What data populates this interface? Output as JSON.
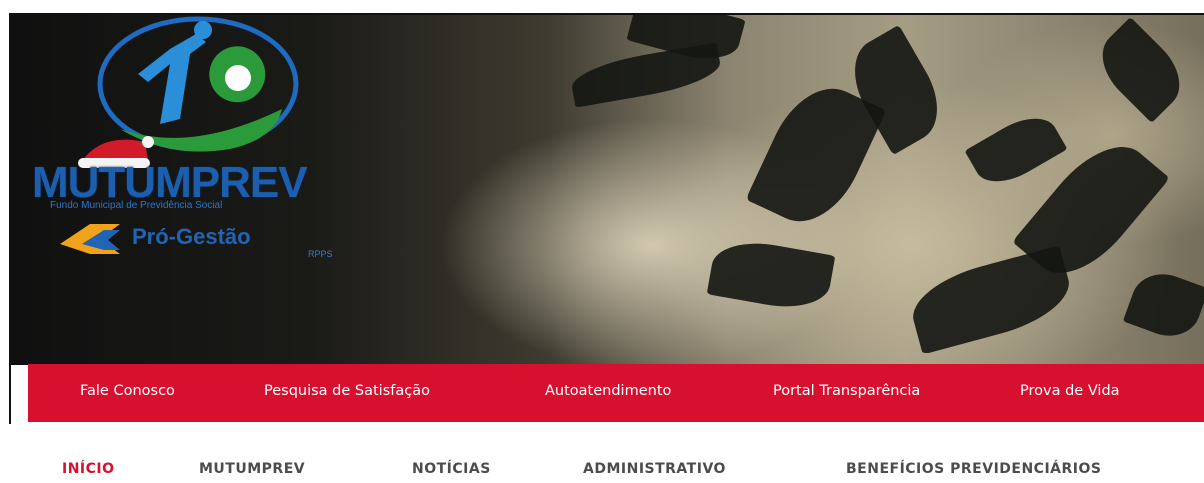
{
  "logo": {
    "brand_name": "MUTUMPREV",
    "brand_subtitle": "Fundo Municipal de Previdência Social",
    "certification": "Pró-Gestão",
    "certification_sub": "RPPS"
  },
  "top_nav": {
    "items": [
      {
        "label": "Fale Conosco"
      },
      {
        "label": "Pesquisa de Satisfação"
      },
      {
        "label": "Autoatendimento"
      },
      {
        "label": "Portal Transparência"
      },
      {
        "label": "Prova de Vida"
      }
    ],
    "background_color": "#d8102f"
  },
  "main_nav": {
    "items": [
      {
        "label": "INÍCIO",
        "active": true
      },
      {
        "label": "MUTUMPREV"
      },
      {
        "label": "NOTÍCIAS"
      },
      {
        "label": "ADMINISTRATIVO"
      },
      {
        "label": "BENEFÍCIOS PREVIDENCIÁRIOS"
      }
    ],
    "active_color": "#d8102f"
  },
  "icons": [
    "mutumprev-logo-icon",
    "santa-hat-icon",
    "pro-gestao-logo-icon"
  ]
}
